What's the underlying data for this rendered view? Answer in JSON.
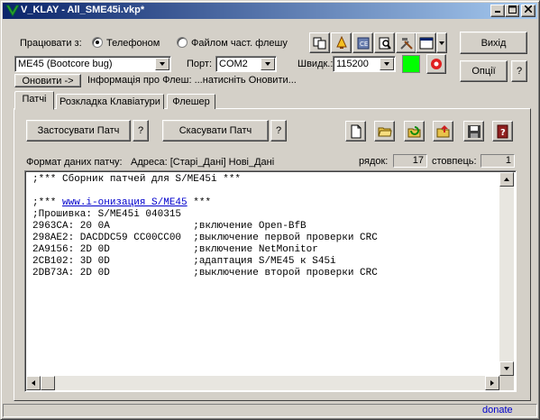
{
  "window": {
    "title": "V_KLAY - All_SME45i.vkp*"
  },
  "connection": {
    "work_with_label": "Працювати з:",
    "phone_option": "Телефоном",
    "flash_file_option": "Файлом част. флешу",
    "selected": "phone"
  },
  "toolbar": {
    "exit_button": "Вихід",
    "options_button": "Опції",
    "help_button": "?"
  },
  "device": {
    "model_value": "ME45 (Bootcore bug)",
    "port_label": "Порт:",
    "port_value": "COM2",
    "speed_label": "Швидк.:",
    "speed_value": "115200",
    "status_color": "#00ff00",
    "update_button": "Оновити ->",
    "flash_info": "Інформація про Флеш: ...натисніть Оновити..."
  },
  "tabs": [
    {
      "label": "Патчі",
      "active": true
    },
    {
      "label": "Розкладка Клавіатури",
      "active": false
    },
    {
      "label": "Флешер",
      "active": false
    }
  ],
  "patches": {
    "apply_button": "Застосувати Патч",
    "apply_help": "?",
    "cancel_button": "Скасувати Патч",
    "cancel_help": "?",
    "format_label": "Формат даних патчу:",
    "address_label": "Адреса: [Старі_Дані] Нові_Дані",
    "row_label": "рядок:",
    "row_value": "17",
    "col_label": "стовпець:",
    "col_value": "1"
  },
  "editor": {
    "lines": [
      {
        "text": ";*** Сборник патчей для S/ME45i ***"
      },
      {
        "text": ""
      },
      {
        "prefix": ";*** ",
        "link": "www.i-онизация S/ME45",
        "suffix": " ***"
      },
      {
        "text": ";Прошивка: S/ME45i 040315"
      },
      {
        "text": "2963CA: 20 0A              ;включение Open-BfB"
      },
      {
        "text": "298AE2: DACDDC59 CC00CC00  ;выключение первой проверки CRC"
      },
      {
        "text": "2A9156: 2D 0D              ;включение NetMonitor"
      },
      {
        "text": "2CB102: 3D 0D              ;адаптация S/ME45 к S45i"
      },
      {
        "text": "2DB73A: 2D 0D              ;выключение второй проверки CRC"
      }
    ]
  },
  "status": {
    "donate": "donate"
  },
  "icons": {
    "new": "new-file-icon",
    "open": "open-folder-icon",
    "refresh": "refresh-folder-icon",
    "export": "export-folder-icon",
    "save": "floppy-save-icon",
    "help": "help-book-icon"
  }
}
